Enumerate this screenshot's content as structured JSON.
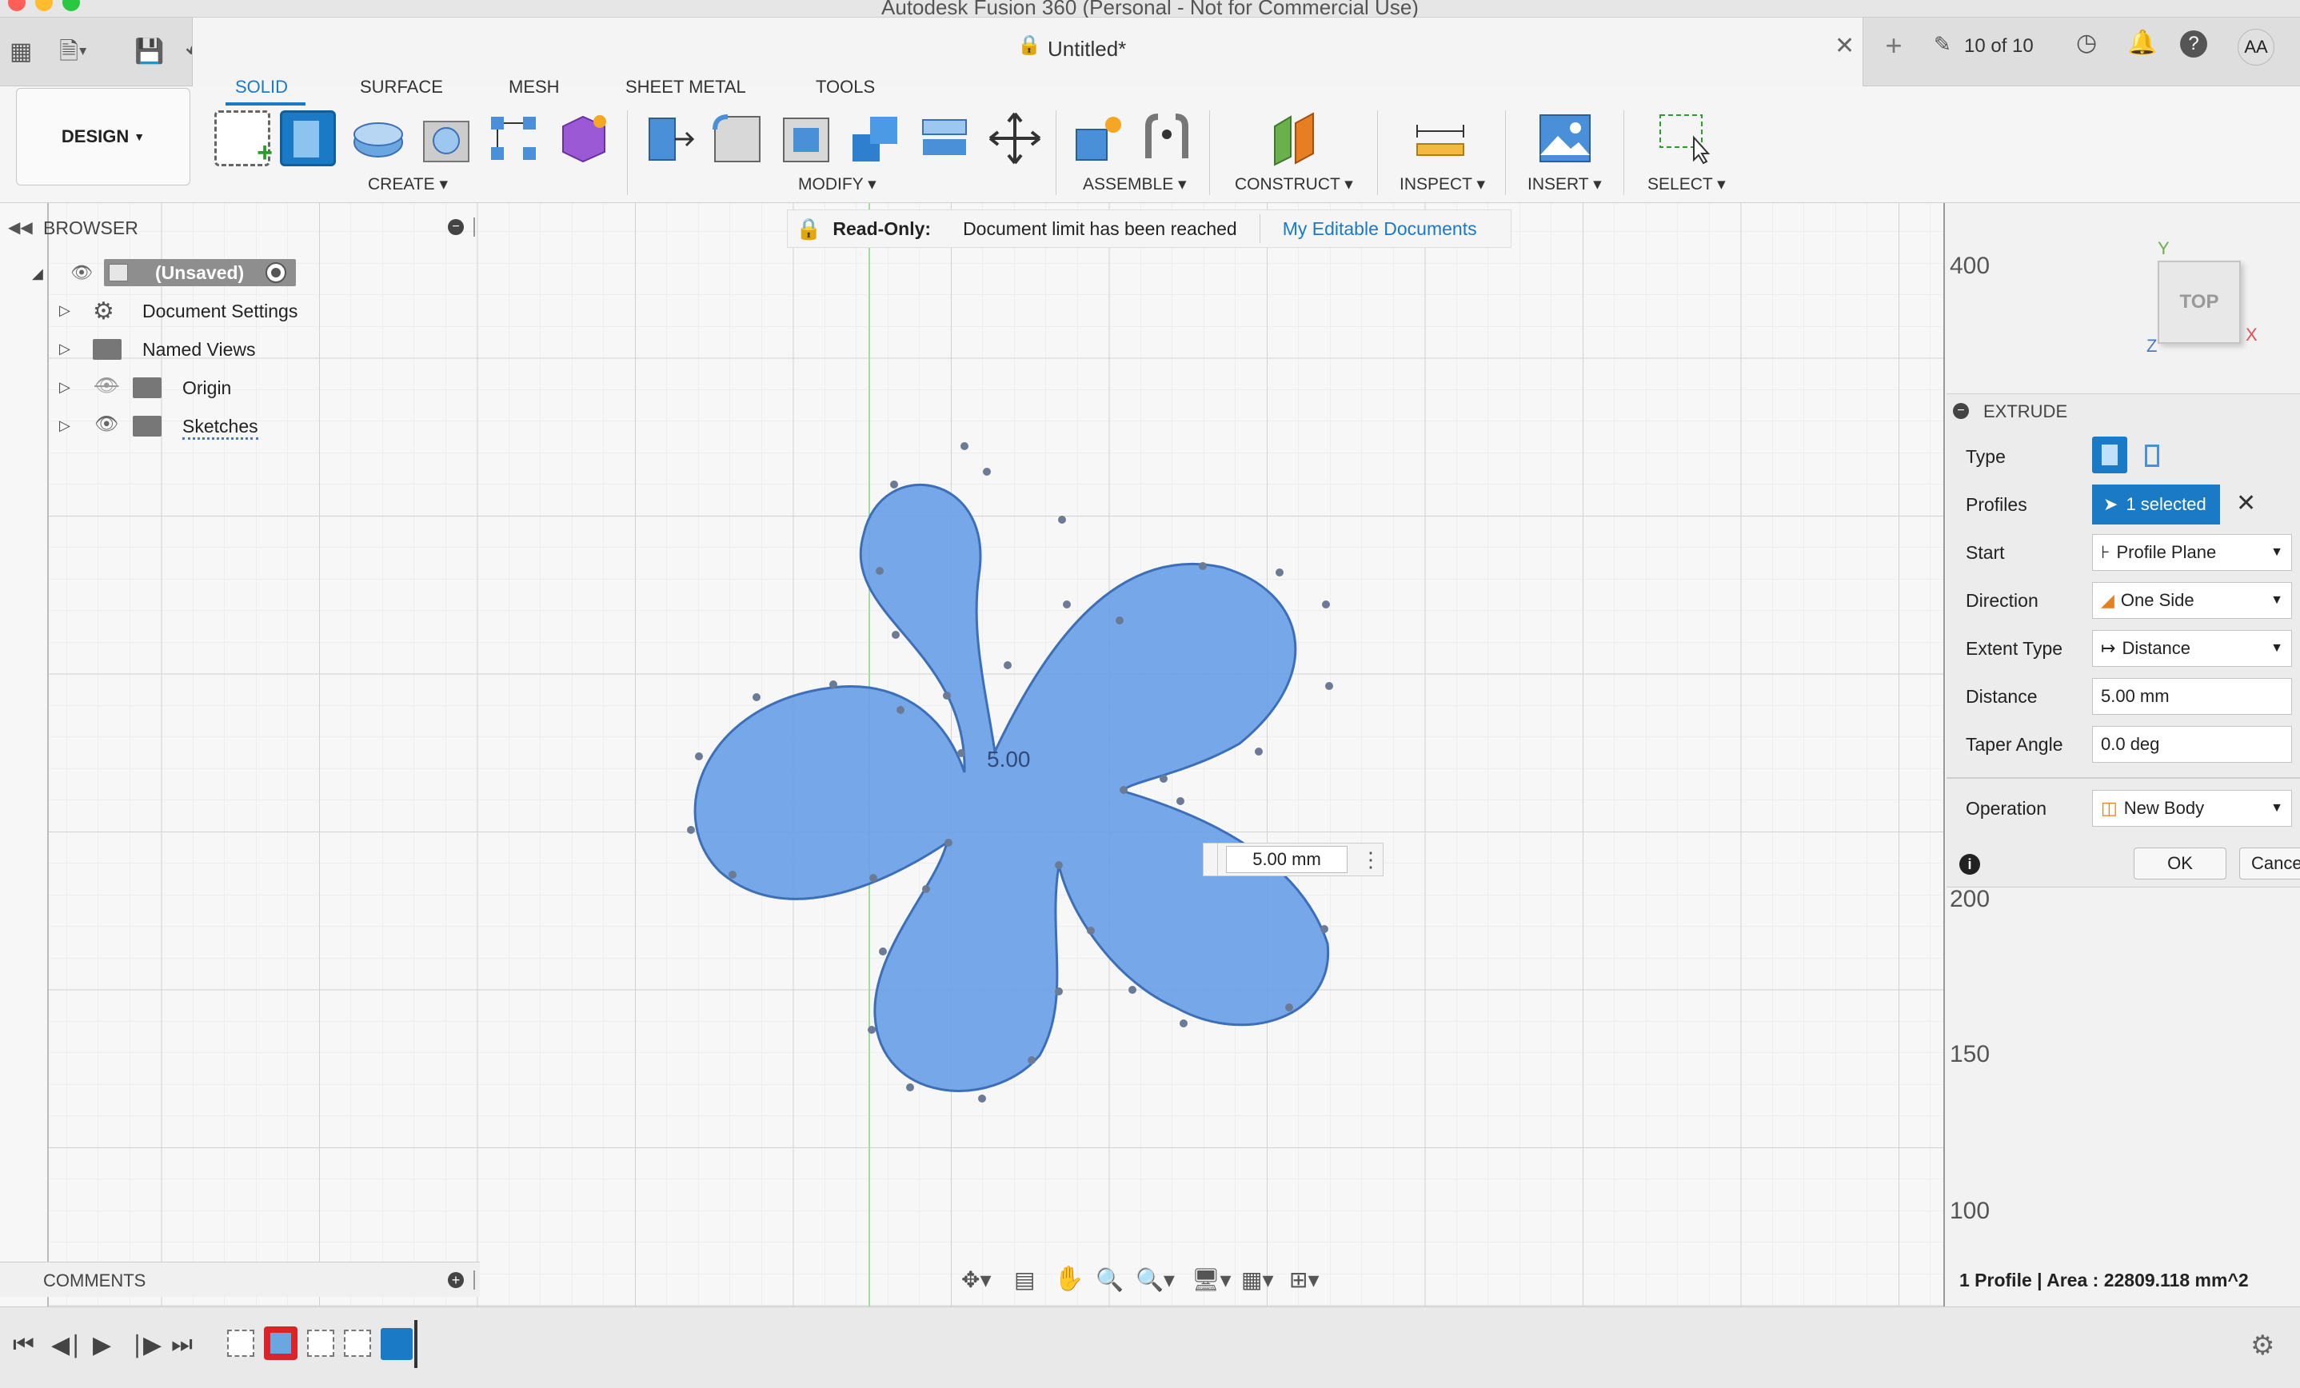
{
  "window": {
    "title": "Autodesk Fusion 360 (Personal - Not for Commercial Use)"
  },
  "tabbar": {
    "doc_title": "Untitled*",
    "job_counter": "10 of 10",
    "user_initials": "AA"
  },
  "toolbar": {
    "workspace": "DESIGN",
    "tabs": [
      "SOLID",
      "SURFACE",
      "MESH",
      "SHEET METAL",
      "TOOLS"
    ],
    "groups": [
      "CREATE",
      "MODIFY",
      "ASSEMBLE",
      "CONSTRUCT",
      "INSPECT",
      "INSERT",
      "SELECT"
    ]
  },
  "banner": {
    "label": "Read-Only:",
    "message": "Document limit has been reached",
    "link": "My Editable Documents"
  },
  "browser": {
    "title": "BROWSER",
    "root": "(Unsaved)",
    "items": [
      "Document Settings",
      "Named Views",
      "Origin",
      "Sketches"
    ]
  },
  "viewcube": {
    "face": "TOP",
    "axis_x": "X",
    "axis_y": "Y",
    "axis_z": "Z"
  },
  "ruler": {
    "ticks": [
      "400",
      "200",
      "150",
      "100"
    ]
  },
  "canvas": {
    "center_label": "5.00",
    "distance_input": "5.00 mm",
    "status": "1 Profile | Area : 22809.118 mm^2"
  },
  "extrude": {
    "title": "EXTRUDE",
    "labels": {
      "type": "Type",
      "profiles": "Profiles",
      "start": "Start",
      "direction": "Direction",
      "extent_type": "Extent Type",
      "distance": "Distance",
      "taper": "Taper Angle",
      "operation": "Operation"
    },
    "profiles_value": "1 selected",
    "start_value": "Profile Plane",
    "direction_value": "One Side",
    "extent_value": "Distance",
    "distance_value": "5.00 mm",
    "taper_value": "0.0 deg",
    "operation_value": "New Body",
    "ok": "OK",
    "cancel": "Cancel"
  },
  "comments": {
    "title": "COMMENTS"
  },
  "colors": {
    "accent": "#1a7ac6",
    "profile_fill": "#6a9fe6",
    "profile_stroke": "#3d6fb8"
  }
}
